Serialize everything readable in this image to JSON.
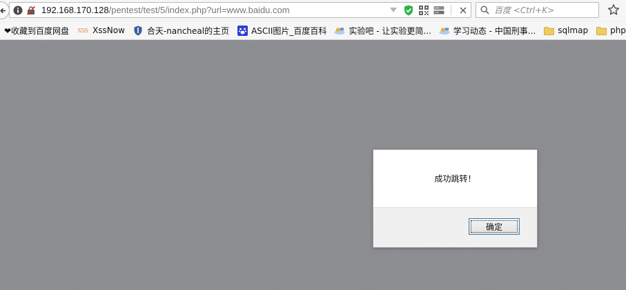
{
  "nav": {
    "url_host": "192.168.170.128",
    "url_path": "/pentest/test/5/index.php?url=www.baidu.com",
    "search_placeholder": "百度 <Ctrl+K>"
  },
  "bookmarks": [
    {
      "label": "❤收藏到百度网盘"
    },
    {
      "icon_text": "XSS",
      "label": "XssNow"
    },
    {
      "label": "合天-nancheal的主页"
    },
    {
      "label": "ASCII图片_百度百科"
    },
    {
      "label": "实验吧 - 让实验更简..."
    },
    {
      "label": "学习动态 - 中国刑事..."
    },
    {
      "label": "sqlmap"
    },
    {
      "label": "php"
    }
  ],
  "dialog": {
    "message": "成功跳转！",
    "ok_label": "确定"
  },
  "colors": {
    "content_overlay": "#8b8c8f",
    "shield_green": "#2fb24b",
    "dialog_button_border": "#3c7fb1"
  }
}
